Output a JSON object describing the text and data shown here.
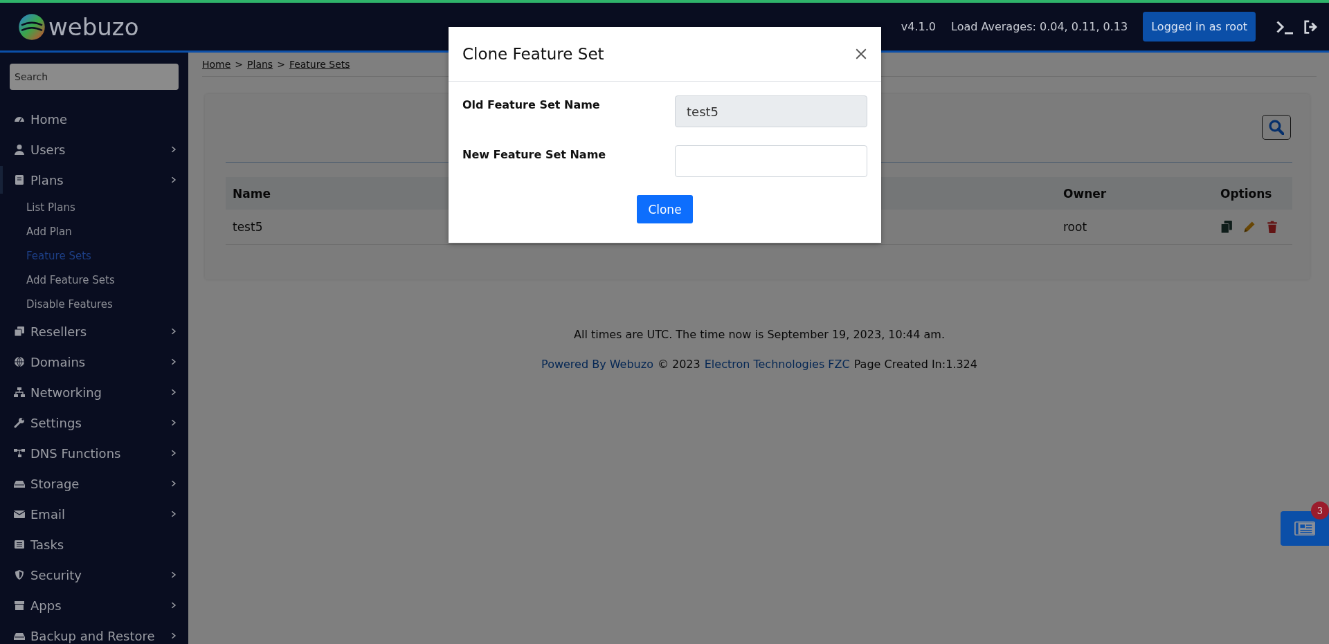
{
  "header": {
    "logo": "webuzo",
    "version": "v4.1.0",
    "load": "Load Averages: 0.04, 0.11, 0.13",
    "user_button": "Logged in as root"
  },
  "sidebar": {
    "search_placeholder": "Search",
    "items": [
      {
        "label": "Home",
        "has_submenu": false,
        "expanded": false
      },
      {
        "label": "Users",
        "has_submenu": true,
        "expanded": false
      },
      {
        "label": "Plans",
        "has_submenu": true,
        "expanded": true,
        "children": [
          {
            "label": "List Plans",
            "selected": false
          },
          {
            "label": "Add Plan",
            "selected": false
          },
          {
            "label": "Feature Sets",
            "selected": true
          },
          {
            "label": "Add Feature Sets",
            "selected": false
          },
          {
            "label": "Disable Features",
            "selected": false
          }
        ]
      },
      {
        "label": "Resellers",
        "has_submenu": true,
        "expanded": false
      },
      {
        "label": "Domains",
        "has_submenu": true,
        "expanded": false
      },
      {
        "label": "Networking",
        "has_submenu": true,
        "expanded": false
      },
      {
        "label": "Settings",
        "has_submenu": true,
        "expanded": false
      },
      {
        "label": "DNS Functions",
        "has_submenu": true,
        "expanded": false
      },
      {
        "label": "Storage",
        "has_submenu": true,
        "expanded": false
      },
      {
        "label": "Email",
        "has_submenu": true,
        "expanded": false
      },
      {
        "label": "Tasks",
        "has_submenu": false,
        "expanded": false
      },
      {
        "label": "Security",
        "has_submenu": true,
        "expanded": false
      },
      {
        "label": "Apps",
        "has_submenu": true,
        "expanded": false
      },
      {
        "label": "Backup and Restore",
        "has_submenu": true,
        "expanded": false
      }
    ]
  },
  "breadcrumb": {
    "separator": ">",
    "items": [
      "Home",
      "Plans",
      "Feature Sets"
    ]
  },
  "table": {
    "columns": [
      "Name",
      "Owner",
      "Options"
    ],
    "rows": [
      {
        "cells": [
          "test5",
          "root"
        ]
      }
    ]
  },
  "footer": {
    "time_note": "All times are UTC. The time now is September 19, 2023, 10:44 am.",
    "powered_by": "Powered By Webuzo",
    "copyright": "© 2023",
    "company": "Electron Technologies FZC",
    "page_created": "Page Created In:1.324"
  },
  "modal": {
    "title": "Clone Feature Set",
    "fields": [
      {
        "label": "Old Feature Set Name",
        "value": "test5",
        "disabled": true
      },
      {
        "label": "New Feature Set Name",
        "disabled": false
      }
    ],
    "button": "Clone"
  },
  "news_button": {
    "badge": "3"
  }
}
